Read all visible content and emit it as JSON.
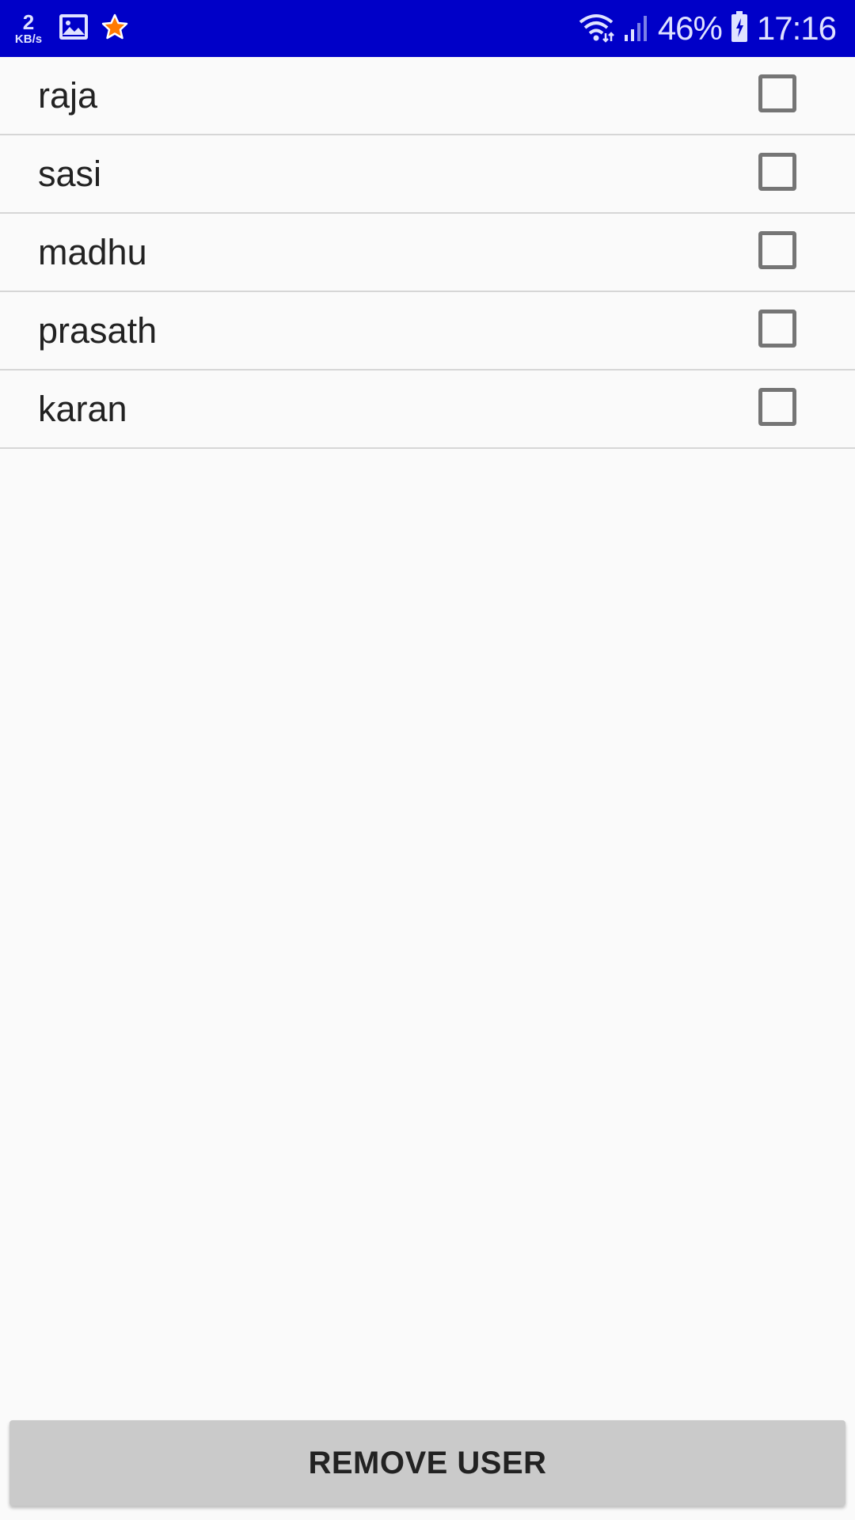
{
  "status_bar": {
    "background": "#0000c8",
    "net_speed_value": "2",
    "net_speed_unit": "KB/s",
    "icons_left": [
      "image-icon",
      "star-icon"
    ],
    "icons_right": [
      "wifi-icon",
      "signal-icon",
      "battery-icon"
    ],
    "battery_percent": "46%",
    "time": "17:16"
  },
  "users": [
    {
      "name": "raja",
      "checked": false
    },
    {
      "name": "sasi",
      "checked": false
    },
    {
      "name": "madhu",
      "checked": false
    },
    {
      "name": "prasath",
      "checked": false
    },
    {
      "name": "karan",
      "checked": false
    }
  ],
  "actions": {
    "remove_label": "REMOVE USER"
  }
}
